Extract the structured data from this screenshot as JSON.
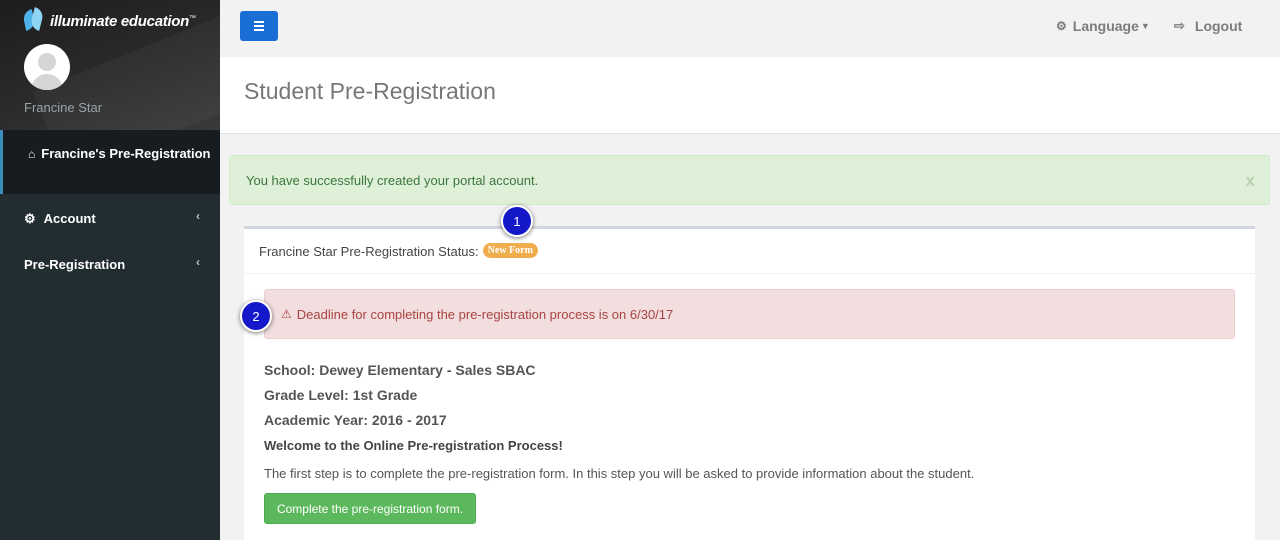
{
  "brand": {
    "logo_text": "illuminate education",
    "trademark": "™"
  },
  "sidebar": {
    "user_name": "Francine Star",
    "active_item": "Francine's Pre-Registration",
    "items": [
      {
        "label": "Account",
        "icon": "gear-icon"
      },
      {
        "label": "Pre-Registration",
        "icon": ""
      }
    ]
  },
  "header": {
    "language_label": "Language",
    "logout_label": "Logout"
  },
  "page": {
    "title": "Student Pre-Registration"
  },
  "alert": {
    "message": "You have successfully created your portal account.",
    "close_label": "x"
  },
  "status": {
    "label": "Francine Star Pre-Registration Status:",
    "badge": "New Form"
  },
  "deadline": {
    "message": "Deadline for completing the pre-registration process is on 6/30/17"
  },
  "details": {
    "school": "School: Dewey Elementary - Sales SBAC",
    "grade": "Grade Level: 1st Grade",
    "year": "Academic Year: 2016 - 2017",
    "welcome": "Welcome to the Online Pre-registration Process!",
    "instructions": "The first step is to complete the pre-registration form. In this step you will be asked to provide information about the student.",
    "button_label": "Complete the pre-registration form."
  },
  "callouts": [
    "1",
    "2"
  ],
  "colors": {
    "sidebar_bg": "#222d32",
    "accent": "#3c8dbc",
    "menu_button": "#1b6ed6",
    "success_bg": "#dff0d8",
    "danger_bg": "#f2dede",
    "badge": "#f0ad4e",
    "primary_action": "#5cb85c",
    "callout": "#1418c8"
  }
}
